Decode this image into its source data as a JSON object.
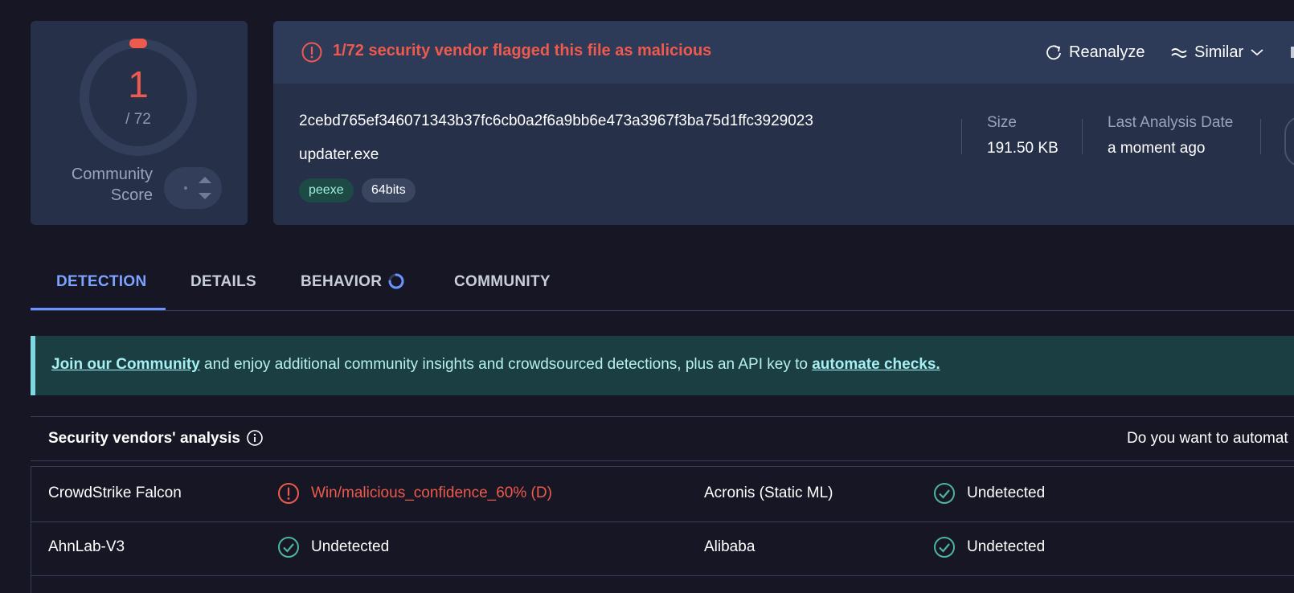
{
  "score": {
    "detections": "1",
    "total": "/ 72",
    "community_label_1": "Community",
    "community_label_2": "Score"
  },
  "summary": {
    "alert": "1/72 security vendor flagged this file as malicious",
    "reanalyze_label": "Reanalyze",
    "similar_label": "Similar",
    "hash": "2cebd765ef346071343b37fc6cb0a2f6a9bb6e473a3967f3ba75d1ffc3929023",
    "filename": "updater.exe",
    "tags": [
      "peexe",
      "64bits"
    ],
    "size_label": "Size",
    "size_value": "191.50 KB",
    "date_label": "Last Analysis Date",
    "date_value": "a moment ago"
  },
  "tabs": [
    "DETECTION",
    "DETAILS",
    "BEHAVIOR",
    "COMMUNITY"
  ],
  "banner": {
    "link1": "Join our Community",
    "text": " and enjoy additional community insights and crowdsourced detections, plus an API key to ",
    "link2": "automate checks."
  },
  "vendors": {
    "title": "Security vendors' analysis",
    "right_text": "Do you want to automat",
    "rows": [
      {
        "v1": "CrowdStrike Falcon",
        "r1": "Win/malicious_confidence_60% (D)",
        "v2": "Acronis (Static ML)",
        "r2": "Undetected"
      },
      {
        "v1": "AhnLab-V3",
        "r1": "Undetected",
        "v2": "Alibaba",
        "r2": "Undetected"
      }
    ]
  },
  "colors": {
    "malicious": "#ee5a4d",
    "accent": "#7ea3ff",
    "undetected": "#4fb59a"
  }
}
